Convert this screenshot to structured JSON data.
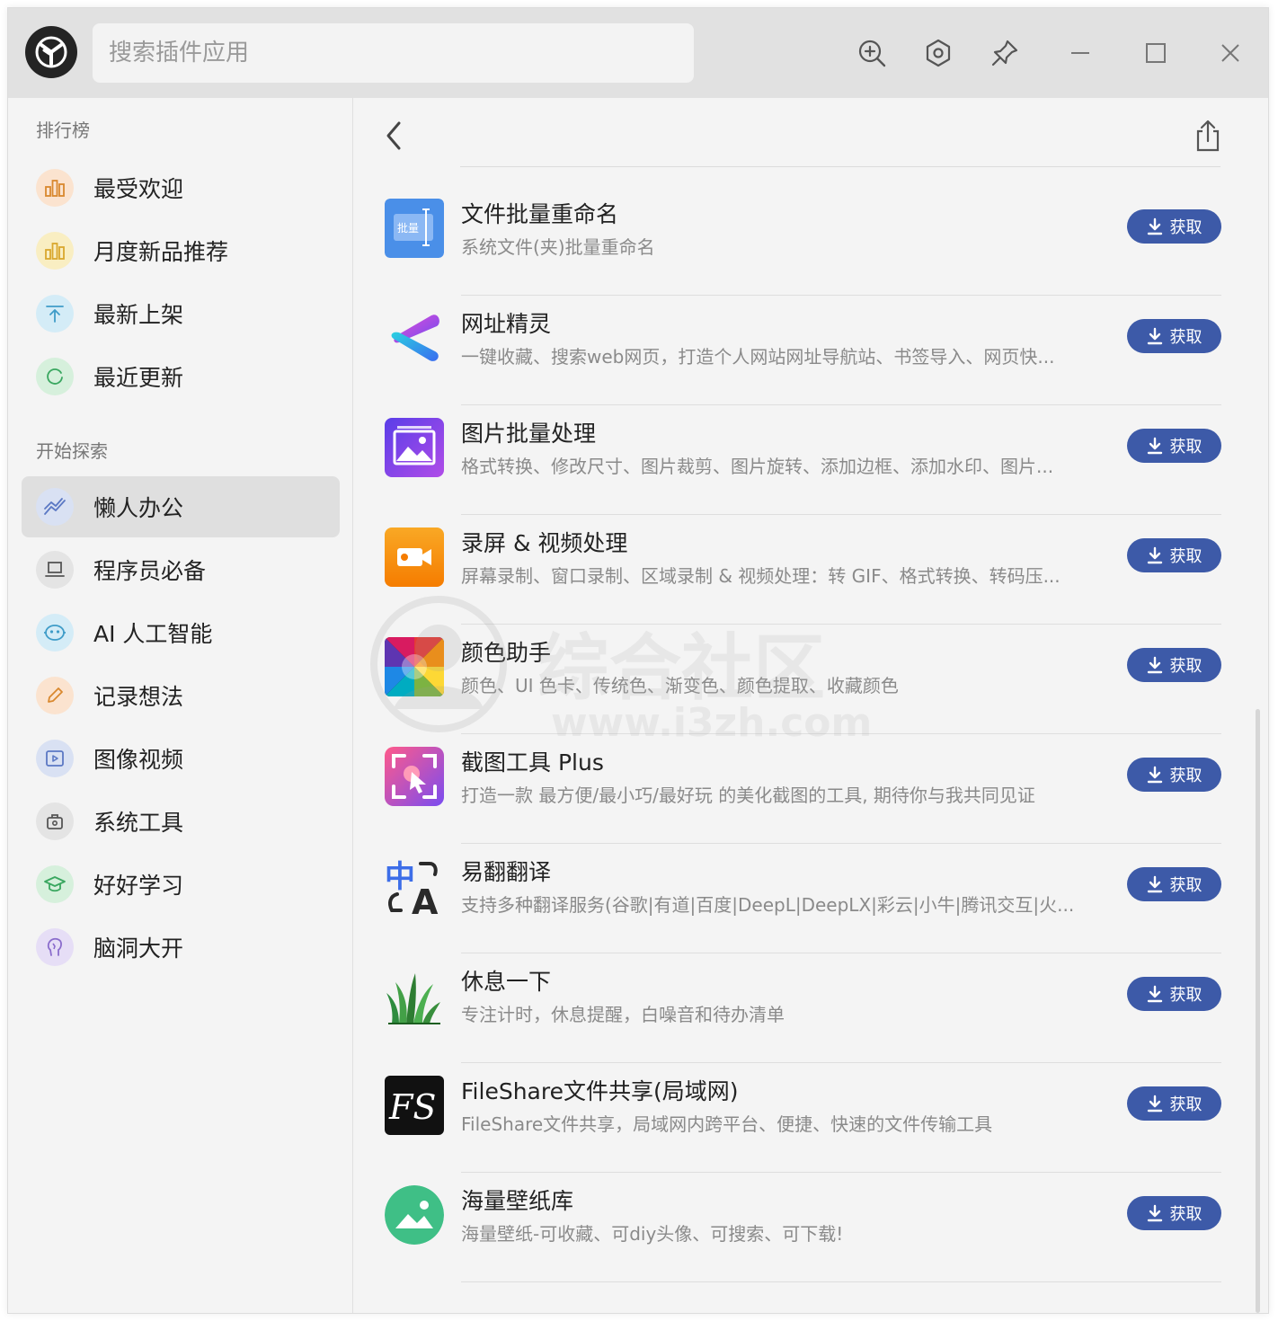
{
  "search": {
    "placeholder": "搜索插件应用"
  },
  "sidebar": {
    "ranking_title": "排行榜",
    "explore_title": "开始探索",
    "ranking": [
      {
        "label": "最受欢迎"
      },
      {
        "label": "月度新品推荐"
      },
      {
        "label": "最新上架"
      },
      {
        "label": "最近更新"
      }
    ],
    "explore": [
      {
        "label": "懒人办公"
      },
      {
        "label": "程序员必备"
      },
      {
        "label": "AI 人工智能"
      },
      {
        "label": "记录想法"
      },
      {
        "label": "图像视频"
      },
      {
        "label": "系统工具"
      },
      {
        "label": "好好学习"
      },
      {
        "label": "脑洞大开"
      }
    ]
  },
  "main": {
    "get_label": "获取",
    "apps": [
      {
        "name": "文件批量重命名",
        "desc": "系统文件(夹)批量重命名",
        "icon_text": "批量"
      },
      {
        "name": "网址精灵",
        "desc": "一键收藏、搜索web网页，打造个人网站网址导航站、书签导入、网页快..."
      },
      {
        "name": "图片批量处理",
        "desc": "格式转换、修改尺寸、图片裁剪、图片旋转、添加边框、添加水印、图片..."
      },
      {
        "name": "录屏 & 视频处理",
        "desc": "屏幕录制、窗口录制、区域录制 & 视频处理：转 GIF、格式转换、转码压..."
      },
      {
        "name": "颜色助手",
        "desc": "颜色、UI 色卡、传统色、渐变色、颜色提取、收藏颜色"
      },
      {
        "name": "截图工具 Plus",
        "desc": "打造一款 最方便/最小巧/最好玩 的美化截图的工具, 期待你与我共同见证"
      },
      {
        "name": "易翻翻译",
        "desc": "支持多种翻译服务(谷歌|有道|百度|DeepL|DeepLX|彩云|小牛|腾讯交互|火...",
        "icon_text_1": "中",
        "icon_text_2": "A"
      },
      {
        "name": "休息一下",
        "desc": "专注计时，休息提醒，白噪音和待办清单"
      },
      {
        "name": "FileShare文件共享(局域网)",
        "desc": "FileShare文件共享，局域网内跨平台、便捷、快速的文件传输工具",
        "icon_text": "FS"
      },
      {
        "name": "海量壁纸库",
        "desc": "海量壁纸-可收藏、可diy头像、可搜索、可下载!"
      }
    ]
  },
  "watermark": {
    "text": "综合社区",
    "url": "www.i3zh.com"
  }
}
